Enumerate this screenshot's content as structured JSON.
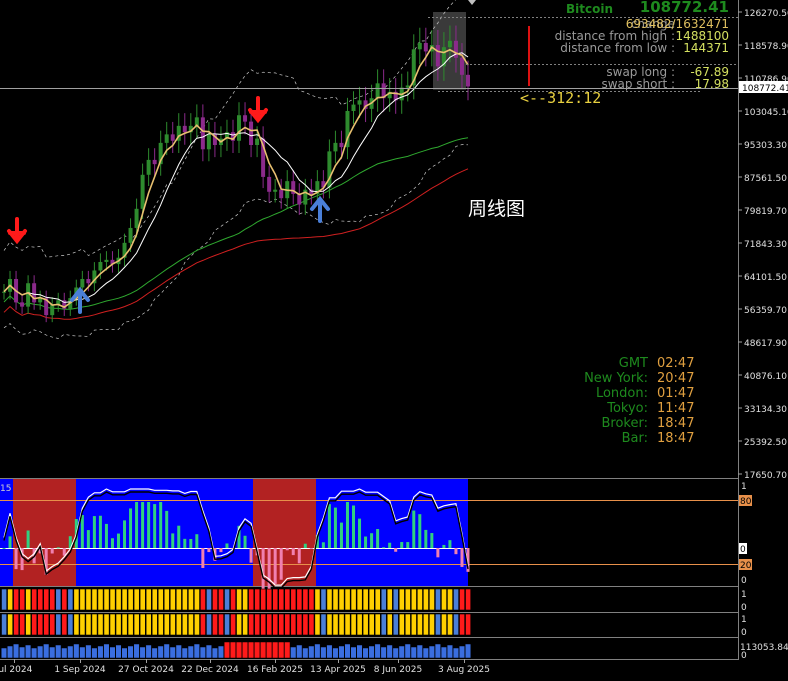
{
  "symbol": "Bitcoin",
  "last_price": "108772.41",
  "info": [
    {
      "label": "change",
      "value": "693482/1632471"
    },
    {
      "label": "distance from high :",
      "value": "1488100"
    },
    {
      "label": "distance from low :",
      "value": "144371"
    },
    {
      "label": "swap long :",
      "value": "-67.89"
    },
    {
      "label": "swap short :",
      "value": "17.98"
    }
  ],
  "countdown": "<--312:12",
  "chart_title": "周线图",
  "clocks": [
    {
      "label": "GMT",
      "value": "02:47"
    },
    {
      "label": "New York:",
      "value": "20:47"
    },
    {
      "label": "London:",
      "value": "01:47"
    },
    {
      "label": "Tokyo:",
      "value": "11:47"
    },
    {
      "label": "Broker:",
      "value": "18:47"
    },
    {
      "label": "Bar:",
      "value": "18:47"
    }
  ],
  "price_axis": [
    "126270.50",
    "118578.90",
    "110786.90",
    "103045.10",
    "95303.30",
    "87561.50",
    "79819.70",
    "71843.30",
    "64101.50",
    "56359.70",
    "48617.90",
    "40876.10",
    "33134.30",
    "25392.50",
    "17650.70"
  ],
  "price_axis_marker": "108772.41",
  "osc_axis": {
    "top": "1",
    "upper": "80",
    "mid": "0",
    "lower": "20",
    "bottom": "0"
  },
  "osc_corner": "15",
  "row_axis": [
    {
      "top": "1",
      "bottom": "0"
    },
    {
      "top": "1",
      "bottom": "0"
    }
  ],
  "vol_axis": {
    "top": "113053.84",
    "bottom": "0"
  },
  "date_axis": [
    "Jul 2024",
    "1 Sep 2024",
    "27 Oct 2024",
    "22 Dec 2024",
    "16 Feb 2025",
    "13 Apr 2025",
    "8 Jun 2025",
    "3 Aug 2025"
  ],
  "colors": {
    "bull": "#2e8b2e",
    "bear": "#8b2a8b",
    "ma_fast": "#e8c070",
    "ma_mid": "#ffffff",
    "ma_slow1": "#2fa82f",
    "ma_slow2": "#d02020",
    "osc_bg": "#0000ff",
    "osc_zone": "#b22222",
    "label_green": "#1e8a1e",
    "value_orange": "#e0a040"
  },
  "chart_data": {
    "type": "candlestick",
    "timeframe": "weekly",
    "ylim": [
      17650.7,
      126270.5
    ],
    "close_series": [
      60500,
      63500,
      58000,
      57000,
      62500,
      58000,
      59000,
      55000,
      57500,
      58500,
      56500,
      59000,
      61500,
      63500,
      62500,
      65500,
      67500,
      68000,
      67000,
      68500,
      72000,
      75500,
      80000,
      88000,
      91500,
      90500,
      95500,
      97500,
      96000,
      99500,
      98000,
      99500,
      101500,
      94000,
      97500,
      95000,
      96500,
      98000,
      96000,
      102000,
      100500,
      95000,
      96500,
      87500,
      84000,
      84500,
      82500,
      86500,
      83500,
      81000,
      84500,
      83500,
      86500,
      85000,
      93500,
      95500,
      94500,
      103000,
      104500,
      105500,
      103500,
      106000,
      109500,
      106000,
      107500,
      105500,
      108500,
      109000,
      117500,
      119000,
      117000,
      118500,
      113500,
      118000,
      119500,
      115500,
      111500,
      108772
    ]
  }
}
